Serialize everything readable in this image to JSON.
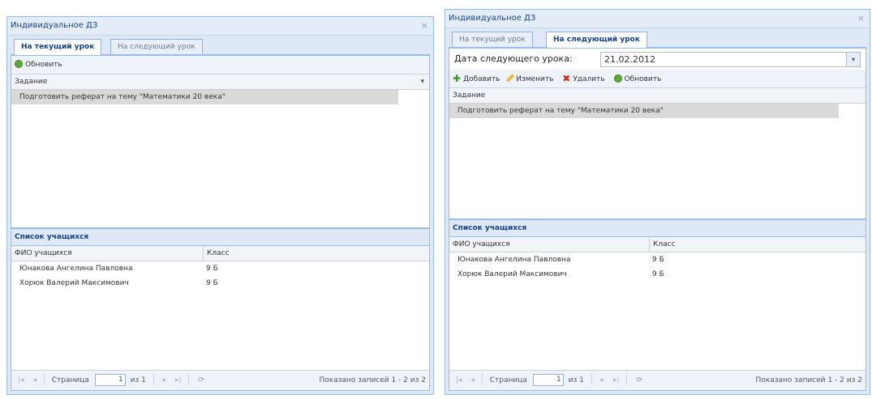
{
  "left": {
    "title": "Индивидуальное ДЗ",
    "close_glyph": "×",
    "tabs": [
      "На текущий урок",
      "На следующий урок"
    ],
    "toolbar": {
      "refresh": "Обновить"
    },
    "tasks": {
      "header": "Задание",
      "rows": [
        "Подготовить реферат на тему \"Математики 20 века\""
      ]
    },
    "students": {
      "section_title": "Список учащихся",
      "col_name": "ФИО учащихся",
      "col_class": "Класс",
      "rows": [
        {
          "name": "Юнакова Ангелина Павловна",
          "class": "9 Б"
        },
        {
          "name": "Хорюк Валерий Максимович",
          "class": "9 Б"
        }
      ]
    },
    "pager": {
      "page_label": "Страница",
      "page_value": "1",
      "of_total": "из 1",
      "info": "Показано записей 1 - 2 из 2"
    }
  },
  "right": {
    "title": "Индивидуальное ДЗ",
    "close_glyph": "×",
    "tabs": [
      "На текущий урок",
      "На следующий урок"
    ],
    "date_label": "Дата следующего урока:",
    "date_value": "21.02.2012",
    "toolbar": {
      "add": "Добавить",
      "edit": "Изменить",
      "delete": "Удалить",
      "refresh": "Обновить"
    },
    "tasks": {
      "header": "Задание",
      "rows": [
        "Подготовить реферат на тему \"Математики 20 века\""
      ]
    },
    "students": {
      "section_title": "Список учащихся",
      "col_name": "ФИО учащихся",
      "col_class": "Класс",
      "rows": [
        {
          "name": "Юнакова Ангелина Павловна",
          "class": "9 Б"
        },
        {
          "name": "Хорюк Валерий Максимович",
          "class": "9 Б"
        }
      ]
    },
    "pager": {
      "page_label": "Страница",
      "page_value": "1",
      "of_total": "из 1",
      "info": "Показано записей 1 - 2 из 2"
    }
  }
}
